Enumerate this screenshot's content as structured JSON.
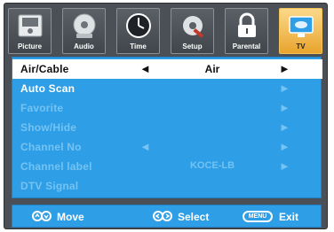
{
  "tabs": [
    {
      "label": "Picture",
      "icon": "picture-icon",
      "active": false
    },
    {
      "label": "Audio",
      "icon": "audio-icon",
      "active": false
    },
    {
      "label": "Time",
      "icon": "clock-icon",
      "active": false
    },
    {
      "label": "Setup",
      "icon": "wrench-icon",
      "active": false
    },
    {
      "label": "Parental",
      "icon": "lock-icon",
      "active": false
    },
    {
      "label": "TV",
      "icon": "satellite-dish-icon",
      "active": true
    }
  ],
  "menu": [
    {
      "name": "Air/Cable",
      "value": "Air",
      "left_arrow": "◄",
      "right_arrow": "►",
      "selected": true,
      "enabled": true
    },
    {
      "name": "Auto Scan",
      "value": "",
      "left_arrow": "",
      "right_arrow": "►",
      "selected": false,
      "enabled": true
    },
    {
      "name": "Favorite",
      "value": "",
      "left_arrow": "",
      "right_arrow": "►",
      "selected": false,
      "enabled": false
    },
    {
      "name": "Show/Hide",
      "value": "",
      "left_arrow": "",
      "right_arrow": "►",
      "selected": false,
      "enabled": false
    },
    {
      "name": "Channel No",
      "value": "",
      "left_arrow": "◄",
      "right_arrow": "►",
      "selected": false,
      "enabled": false
    },
    {
      "name": "Channel label",
      "value": "KOCE-LB",
      "left_arrow": "",
      "right_arrow": "►",
      "selected": false,
      "enabled": false
    },
    {
      "name": "DTV Signal",
      "value": "",
      "left_arrow": "",
      "right_arrow": "",
      "selected": false,
      "enabled": false
    }
  ],
  "hints": {
    "move": "Move",
    "select": "Select",
    "menu_key": "MENU",
    "exit": "Exit"
  },
  "colors": {
    "panel": "#2e9ee6",
    "selected_row": "#ffffff",
    "active_tab": "#e9a42e",
    "frame": "#4a5055"
  }
}
